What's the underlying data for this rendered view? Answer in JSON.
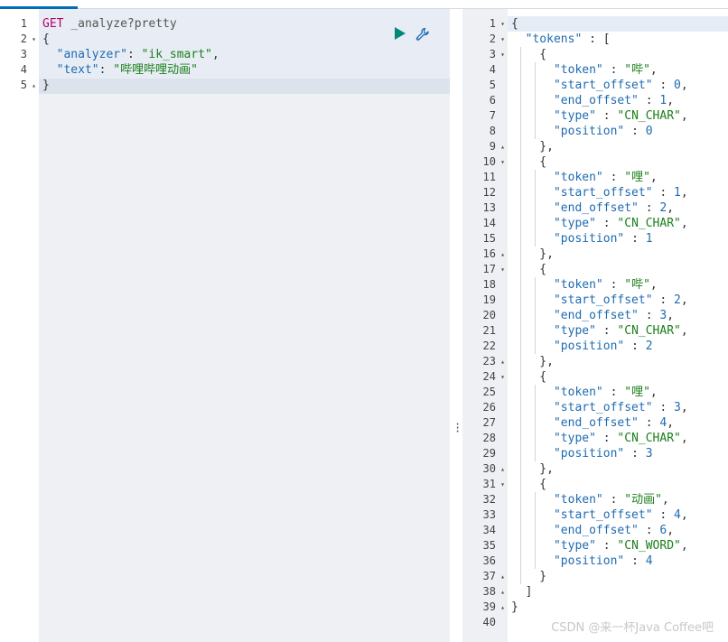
{
  "request_editor": {
    "lines": [
      {
        "n": "1",
        "fold": "",
        "tokens": [
          [
            "kw-method",
            "GET"
          ],
          [
            "kw-url",
            " _analyze?pretty"
          ]
        ]
      },
      {
        "n": "2",
        "fold": "▾",
        "tokens": [
          [
            "punc",
            "{"
          ]
        ]
      },
      {
        "n": "3",
        "fold": "",
        "tokens": [
          [
            "punc",
            "  "
          ],
          [
            "key",
            "\"analyzer\""
          ],
          [
            "punc",
            ": "
          ],
          [
            "str",
            "\"ik_smart\""
          ],
          [
            "punc",
            ","
          ]
        ]
      },
      {
        "n": "4",
        "fold": "",
        "tokens": [
          [
            "punc",
            "  "
          ],
          [
            "key",
            "\"text\""
          ],
          [
            "punc",
            ": "
          ],
          [
            "str",
            "\"哔哩哔哩动画\""
          ]
        ]
      },
      {
        "n": "5",
        "fold": "▴",
        "tokens": [
          [
            "punc",
            "}"
          ]
        ]
      }
    ]
  },
  "toolbar": {
    "run_icon": "play-icon",
    "settings_icon": "wrench-icon"
  },
  "response_editor": {
    "lines": [
      {
        "n": "1",
        "fold": "▾",
        "tokens": [
          [
            "punc",
            "{"
          ]
        ]
      },
      {
        "n": "2",
        "fold": "▾",
        "tokens": [
          [
            "punc",
            "  "
          ],
          [
            "key",
            "\"tokens\""
          ],
          [
            "punc",
            " : ["
          ]
        ]
      },
      {
        "n": "3",
        "fold": "▾",
        "tokens": [
          [
            "punc",
            "    {"
          ]
        ]
      },
      {
        "n": "4",
        "fold": "",
        "tokens": [
          [
            "punc",
            "      "
          ],
          [
            "key",
            "\"token\""
          ],
          [
            "punc",
            " : "
          ],
          [
            "str",
            "\"哔\""
          ],
          [
            "punc",
            ","
          ]
        ]
      },
      {
        "n": "5",
        "fold": "",
        "tokens": [
          [
            "punc",
            "      "
          ],
          [
            "key",
            "\"start_offset\""
          ],
          [
            "punc",
            " : "
          ],
          [
            "num-val",
            "0"
          ],
          [
            "punc",
            ","
          ]
        ]
      },
      {
        "n": "6",
        "fold": "",
        "tokens": [
          [
            "punc",
            "      "
          ],
          [
            "key",
            "\"end_offset\""
          ],
          [
            "punc",
            " : "
          ],
          [
            "num-val",
            "1"
          ],
          [
            "punc",
            ","
          ]
        ]
      },
      {
        "n": "7",
        "fold": "",
        "tokens": [
          [
            "punc",
            "      "
          ],
          [
            "key",
            "\"type\""
          ],
          [
            "punc",
            " : "
          ],
          [
            "str",
            "\"CN_CHAR\""
          ],
          [
            "punc",
            ","
          ]
        ]
      },
      {
        "n": "8",
        "fold": "",
        "tokens": [
          [
            "punc",
            "      "
          ],
          [
            "key",
            "\"position\""
          ],
          [
            "punc",
            " : "
          ],
          [
            "num-val",
            "0"
          ]
        ]
      },
      {
        "n": "9",
        "fold": "▴",
        "tokens": [
          [
            "punc",
            "    },"
          ]
        ]
      },
      {
        "n": "10",
        "fold": "▾",
        "tokens": [
          [
            "punc",
            "    {"
          ]
        ]
      },
      {
        "n": "11",
        "fold": "",
        "tokens": [
          [
            "punc",
            "      "
          ],
          [
            "key",
            "\"token\""
          ],
          [
            "punc",
            " : "
          ],
          [
            "str",
            "\"哩\""
          ],
          [
            "punc",
            ","
          ]
        ]
      },
      {
        "n": "12",
        "fold": "",
        "tokens": [
          [
            "punc",
            "      "
          ],
          [
            "key",
            "\"start_offset\""
          ],
          [
            "punc",
            " : "
          ],
          [
            "num-val",
            "1"
          ],
          [
            "punc",
            ","
          ]
        ]
      },
      {
        "n": "13",
        "fold": "",
        "tokens": [
          [
            "punc",
            "      "
          ],
          [
            "key",
            "\"end_offset\""
          ],
          [
            "punc",
            " : "
          ],
          [
            "num-val",
            "2"
          ],
          [
            "punc",
            ","
          ]
        ]
      },
      {
        "n": "14",
        "fold": "",
        "tokens": [
          [
            "punc",
            "      "
          ],
          [
            "key",
            "\"type\""
          ],
          [
            "punc",
            " : "
          ],
          [
            "str",
            "\"CN_CHAR\""
          ],
          [
            "punc",
            ","
          ]
        ]
      },
      {
        "n": "15",
        "fold": "",
        "tokens": [
          [
            "punc",
            "      "
          ],
          [
            "key",
            "\"position\""
          ],
          [
            "punc",
            " : "
          ],
          [
            "num-val",
            "1"
          ]
        ]
      },
      {
        "n": "16",
        "fold": "▴",
        "tokens": [
          [
            "punc",
            "    },"
          ]
        ]
      },
      {
        "n": "17",
        "fold": "▾",
        "tokens": [
          [
            "punc",
            "    {"
          ]
        ]
      },
      {
        "n": "18",
        "fold": "",
        "tokens": [
          [
            "punc",
            "      "
          ],
          [
            "key",
            "\"token\""
          ],
          [
            "punc",
            " : "
          ],
          [
            "str",
            "\"哔\""
          ],
          [
            "punc",
            ","
          ]
        ]
      },
      {
        "n": "19",
        "fold": "",
        "tokens": [
          [
            "punc",
            "      "
          ],
          [
            "key",
            "\"start_offset\""
          ],
          [
            "punc",
            " : "
          ],
          [
            "num-val",
            "2"
          ],
          [
            "punc",
            ","
          ]
        ]
      },
      {
        "n": "20",
        "fold": "",
        "tokens": [
          [
            "punc",
            "      "
          ],
          [
            "key",
            "\"end_offset\""
          ],
          [
            "punc",
            " : "
          ],
          [
            "num-val",
            "3"
          ],
          [
            "punc",
            ","
          ]
        ]
      },
      {
        "n": "21",
        "fold": "",
        "tokens": [
          [
            "punc",
            "      "
          ],
          [
            "key",
            "\"type\""
          ],
          [
            "punc",
            " : "
          ],
          [
            "str",
            "\"CN_CHAR\""
          ],
          [
            "punc",
            ","
          ]
        ]
      },
      {
        "n": "22",
        "fold": "",
        "tokens": [
          [
            "punc",
            "      "
          ],
          [
            "key",
            "\"position\""
          ],
          [
            "punc",
            " : "
          ],
          [
            "num-val",
            "2"
          ]
        ]
      },
      {
        "n": "23",
        "fold": "▴",
        "tokens": [
          [
            "punc",
            "    },"
          ]
        ]
      },
      {
        "n": "24",
        "fold": "▾",
        "tokens": [
          [
            "punc",
            "    {"
          ]
        ]
      },
      {
        "n": "25",
        "fold": "",
        "tokens": [
          [
            "punc",
            "      "
          ],
          [
            "key",
            "\"token\""
          ],
          [
            "punc",
            " : "
          ],
          [
            "str",
            "\"哩\""
          ],
          [
            "punc",
            ","
          ]
        ]
      },
      {
        "n": "26",
        "fold": "",
        "tokens": [
          [
            "punc",
            "      "
          ],
          [
            "key",
            "\"start_offset\""
          ],
          [
            "punc",
            " : "
          ],
          [
            "num-val",
            "3"
          ],
          [
            "punc",
            ","
          ]
        ]
      },
      {
        "n": "27",
        "fold": "",
        "tokens": [
          [
            "punc",
            "      "
          ],
          [
            "key",
            "\"end_offset\""
          ],
          [
            "punc",
            " : "
          ],
          [
            "num-val",
            "4"
          ],
          [
            "punc",
            ","
          ]
        ]
      },
      {
        "n": "28",
        "fold": "",
        "tokens": [
          [
            "punc",
            "      "
          ],
          [
            "key",
            "\"type\""
          ],
          [
            "punc",
            " : "
          ],
          [
            "str",
            "\"CN_CHAR\""
          ],
          [
            "punc",
            ","
          ]
        ]
      },
      {
        "n": "29",
        "fold": "",
        "tokens": [
          [
            "punc",
            "      "
          ],
          [
            "key",
            "\"position\""
          ],
          [
            "punc",
            " : "
          ],
          [
            "num-val",
            "3"
          ]
        ]
      },
      {
        "n": "30",
        "fold": "▴",
        "tokens": [
          [
            "punc",
            "    },"
          ]
        ]
      },
      {
        "n": "31",
        "fold": "▾",
        "tokens": [
          [
            "punc",
            "    {"
          ]
        ]
      },
      {
        "n": "32",
        "fold": "",
        "tokens": [
          [
            "punc",
            "      "
          ],
          [
            "key",
            "\"token\""
          ],
          [
            "punc",
            " : "
          ],
          [
            "str",
            "\"动画\""
          ],
          [
            "punc",
            ","
          ]
        ]
      },
      {
        "n": "33",
        "fold": "",
        "tokens": [
          [
            "punc",
            "      "
          ],
          [
            "key",
            "\"start_offset\""
          ],
          [
            "punc",
            " : "
          ],
          [
            "num-val",
            "4"
          ],
          [
            "punc",
            ","
          ]
        ]
      },
      {
        "n": "34",
        "fold": "",
        "tokens": [
          [
            "punc",
            "      "
          ],
          [
            "key",
            "\"end_offset\""
          ],
          [
            "punc",
            " : "
          ],
          [
            "num-val",
            "6"
          ],
          [
            "punc",
            ","
          ]
        ]
      },
      {
        "n": "35",
        "fold": "",
        "tokens": [
          [
            "punc",
            "      "
          ],
          [
            "key",
            "\"type\""
          ],
          [
            "punc",
            " : "
          ],
          [
            "str",
            "\"CN_WORD\""
          ],
          [
            "punc",
            ","
          ]
        ]
      },
      {
        "n": "36",
        "fold": "",
        "tokens": [
          [
            "punc",
            "      "
          ],
          [
            "key",
            "\"position\""
          ],
          [
            "punc",
            " : "
          ],
          [
            "num-val",
            "4"
          ]
        ]
      },
      {
        "n": "37",
        "fold": "▴",
        "tokens": [
          [
            "punc",
            "    }"
          ]
        ]
      },
      {
        "n": "38",
        "fold": "▴",
        "tokens": [
          [
            "punc",
            "  ]"
          ]
        ]
      },
      {
        "n": "39",
        "fold": "▴",
        "tokens": [
          [
            "punc",
            "}"
          ]
        ]
      },
      {
        "n": "40",
        "fold": "",
        "tokens": []
      }
    ]
  },
  "watermark": "CSDN @来一杯Java Coffee吧",
  "colors": {
    "accent": "#006bb4",
    "method": "#b8006d",
    "string": "#1a7f1a",
    "key": "#1f6bb0",
    "run": "#00897b"
  }
}
